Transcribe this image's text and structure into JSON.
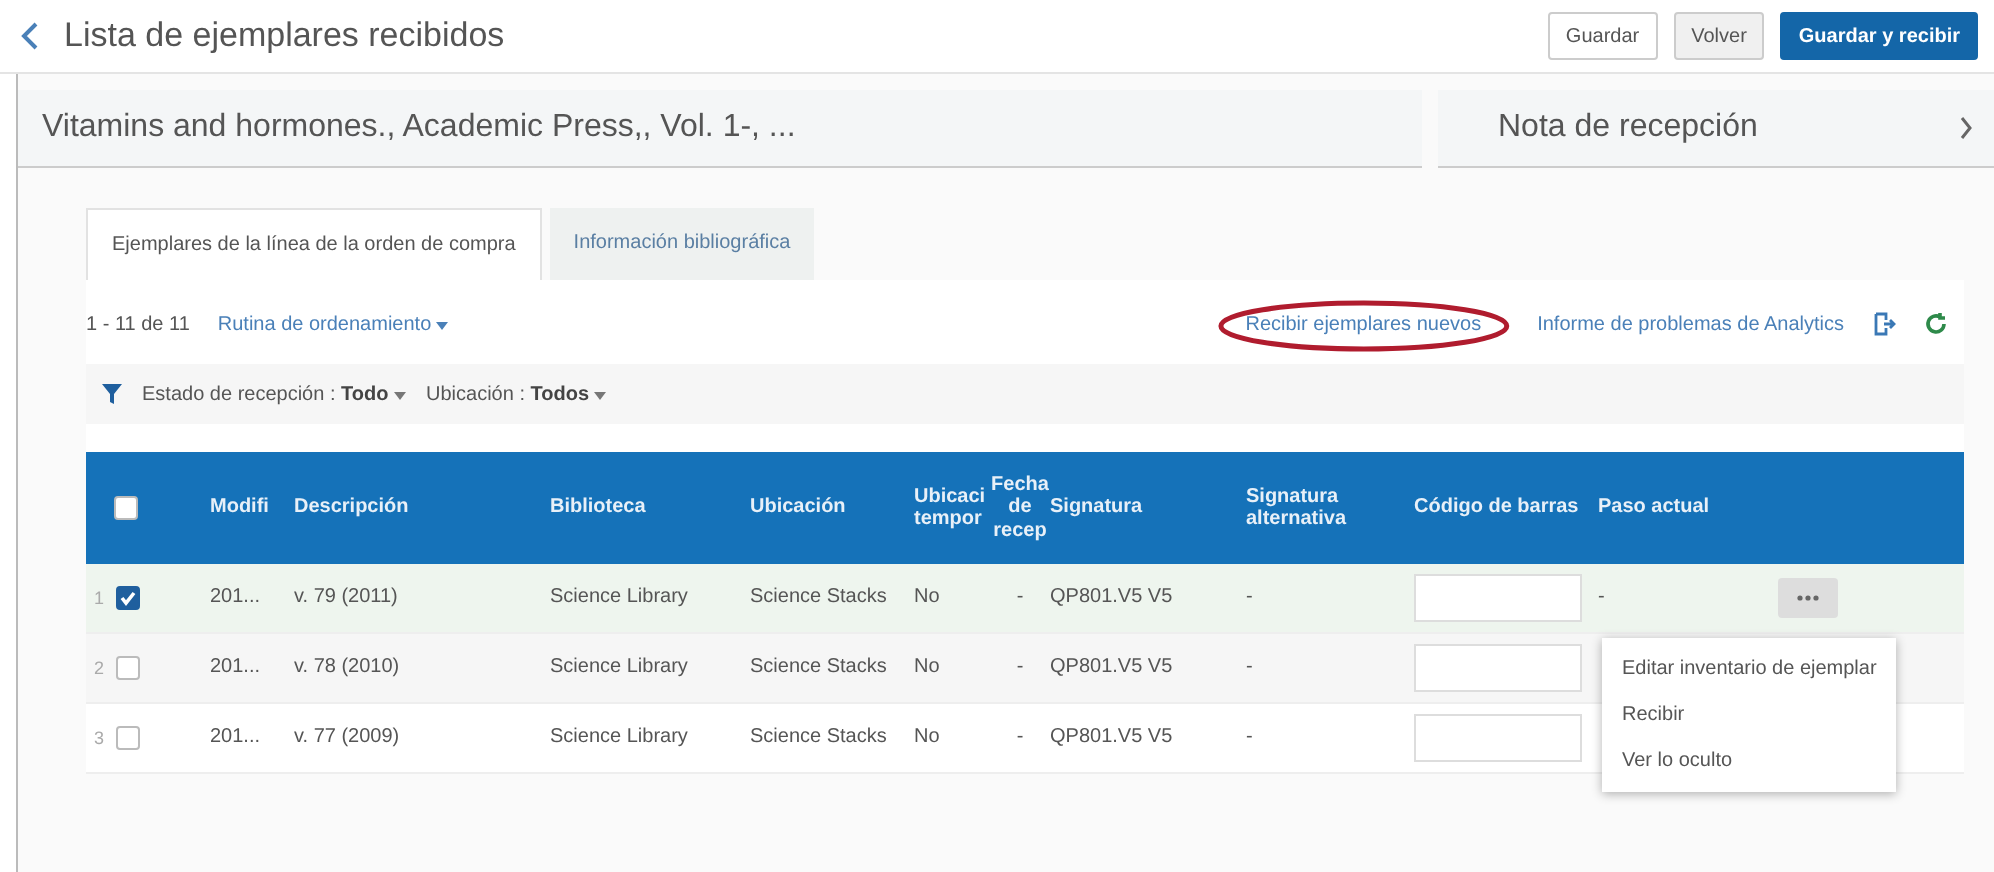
{
  "header": {
    "title": "Lista de ejemplares recibidos",
    "buttons": [
      {
        "label": "Guardar",
        "kind": "secondary"
      },
      {
        "label": "Volver",
        "kind": "muted"
      },
      {
        "label": "Guardar y recibir",
        "kind": "primary"
      }
    ]
  },
  "summary": {
    "title": "Vitamins and hormones., Academic Press,, Vol. 1-, ...",
    "note": "Nota de recepción"
  },
  "tabs": [
    {
      "label": "Ejemplares de la línea de la orden de compra",
      "selected": true
    },
    {
      "label": "Información bibliográfica",
      "selected": false
    }
  ],
  "toolbar": {
    "count": "1 - 11 de 11",
    "sort": "Rutina de ordenamiento",
    "receive_link": "Recibir ejemplares nuevos",
    "analytics_link": "Informe de problemas de Analytics"
  },
  "filters": [
    {
      "label": "Estado de recepción :",
      "value": "Todo"
    },
    {
      "label": "Ubicación :",
      "value": "Todos"
    }
  ],
  "table": {
    "select_all": {
      "checked": false
    },
    "columns": [
      "Modifi",
      "Descripción",
      "Biblioteca",
      "Ubicación",
      "Ubicaci tempor",
      "Fecha de recep",
      "Signatura",
      "Signatura alternativa",
      "Código de barras",
      "Paso actual"
    ],
    "rows": [
      {
        "number": "1",
        "selected": true,
        "cells": [
          "201...",
          "v. 79 (2011)",
          "Science Library",
          "Science Stacks",
          "No",
          "-",
          "QP801.V5 V5",
          "-"
        ],
        "step": "-",
        "menu_button": true
      },
      {
        "number": "2",
        "selected": false,
        "cells": [
          "201...",
          "v. 78 (2010)",
          "Science Library",
          "Science Stacks",
          "No",
          "-",
          "QP801.V5 V5",
          "-"
        ],
        "menu_button": false
      },
      {
        "number": "3",
        "selected": false,
        "cells": [
          "201...",
          "v. 77 (2009)",
          "Science Library",
          "Science Stacks",
          "No",
          "-",
          "QP801.V5 V5",
          "-"
        ],
        "menu_button": false
      }
    ]
  },
  "row_menu": {
    "items": [
      "Editar inventario de ejemplar",
      "Recibir",
      "Ver lo oculto"
    ]
  }
}
